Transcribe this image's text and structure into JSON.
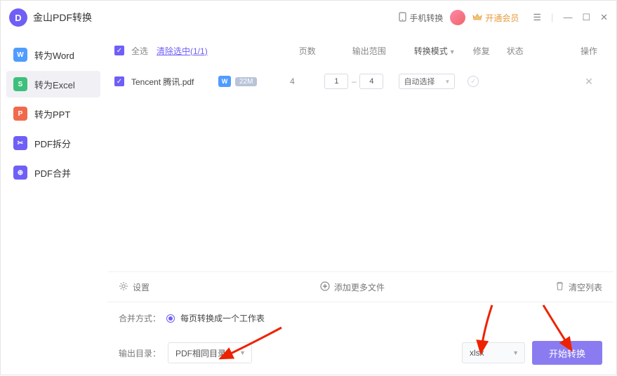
{
  "app": {
    "title": "金山PDF转换"
  },
  "titlebar": {
    "mobile": "手机转换",
    "vip": "开通会员"
  },
  "sidebar": {
    "items": [
      {
        "label": "转为Word",
        "color": "#4f9cff"
      },
      {
        "label": "转为Excel",
        "color": "#3dc07b"
      },
      {
        "label": "转为PPT",
        "color": "#f1694b"
      },
      {
        "label": "PDF拆分",
        "color": "#6f5ff7"
      },
      {
        "label": "PDF合并",
        "color": "#6f5ff7"
      }
    ],
    "active": 1
  },
  "table": {
    "header": {
      "select_all": "全选",
      "clear_sel": "清除选中(1/1)",
      "pages": "页数",
      "range": "输出范围",
      "mode": "转换模式",
      "repair": "修复",
      "status": "状态",
      "ops": "操作"
    },
    "rows": [
      {
        "name": "Tencent 腾讯.pdf",
        "type_icon": "W",
        "size": "22M",
        "pages": "4",
        "range_from": "1",
        "range_to": "4",
        "mode": "自动选择"
      }
    ]
  },
  "toolbar": {
    "settings": "设置",
    "add_more": "添加更多文件",
    "clear_list": "清空列表"
  },
  "bottom": {
    "merge_label": "合并方式：",
    "merge_option": "每页转换成一个工作表",
    "output_label": "输出目录：",
    "dir": "PDF相同目录",
    "format": "xlsx",
    "start": "开始转换"
  }
}
